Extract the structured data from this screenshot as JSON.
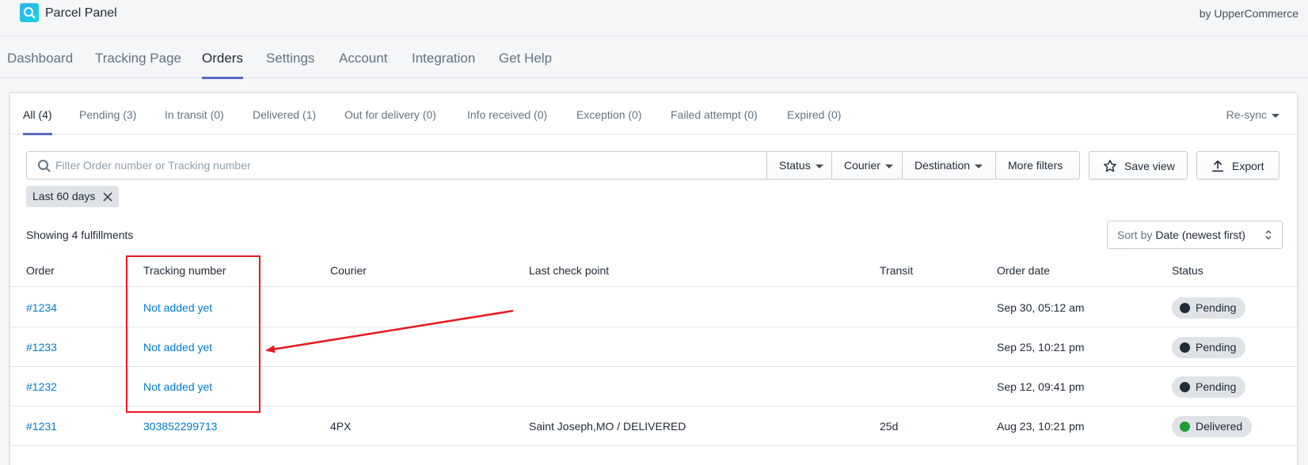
{
  "app": {
    "title": "Parcel Panel",
    "byline": "by UpperCommerce"
  },
  "colors": {
    "accent": "#5c6ac4",
    "link": "#007ace",
    "pending_dot": "#212b36",
    "delivered_dot": "#1e9e35",
    "annotation": "#e8181f"
  },
  "main_nav": [
    {
      "label": "Dashboard",
      "active": false
    },
    {
      "label": "Tracking Page",
      "active": false
    },
    {
      "label": "Orders",
      "active": true
    },
    {
      "label": "Settings",
      "active": false
    },
    {
      "label": "Account",
      "active": false
    },
    {
      "label": "Integration",
      "active": false
    },
    {
      "label": "Get Help",
      "active": false
    }
  ],
  "tabs": [
    {
      "label": "All (4)",
      "active": true
    },
    {
      "label": "Pending (3)",
      "active": false
    },
    {
      "label": "In transit (0)",
      "active": false
    },
    {
      "label": "Delivered (1)",
      "active": false
    },
    {
      "label": "Out for delivery (0)",
      "active": false
    },
    {
      "label": "Info received (0)",
      "active": false
    },
    {
      "label": "Exception (0)",
      "active": false
    },
    {
      "label": "Failed attempt (0)",
      "active": false
    },
    {
      "label": "Expired (0)",
      "active": false
    }
  ],
  "resync_label": "Re-sync",
  "filters": {
    "search_placeholder": "Filter Order number or Tracking number",
    "status": "Status",
    "courier": "Courier",
    "destination": "Destination",
    "more_filters": "More filters",
    "save_view": "Save view",
    "export": "Export"
  },
  "applied_filter": "Last 60 days",
  "showing_text": "Showing 4 fulfillments",
  "sort": {
    "label": "Sort by",
    "value": "Date (newest first)"
  },
  "table": {
    "headers": {
      "order": "Order",
      "tracking": "Tracking number",
      "courier": "Courier",
      "last_check": "Last check point",
      "transit": "Transit",
      "order_date": "Order date",
      "status": "Status"
    },
    "rows": [
      {
        "order": "#1234",
        "tracking": "Not added yet",
        "courier": "",
        "last_check": "",
        "transit": "",
        "order_date": "Sep 30, 05:12 am",
        "status": "Pending"
      },
      {
        "order": "#1233",
        "tracking": "Not added yet",
        "courier": "",
        "last_check": "",
        "transit": "",
        "order_date": "Sep 25, 10:21 pm",
        "status": "Pending"
      },
      {
        "order": "#1232",
        "tracking": "Not added yet",
        "courier": "",
        "last_check": "",
        "transit": "",
        "order_date": "Sep 12, 09:41 pm",
        "status": "Pending"
      },
      {
        "order": "#1231",
        "tracking": "303852299713",
        "courier": "4PX",
        "last_check": "Saint Joseph,MO / DELIVERED",
        "transit": "25d",
        "order_date": "Aug 23, 10:21 pm",
        "status": "Delivered"
      }
    ]
  }
}
